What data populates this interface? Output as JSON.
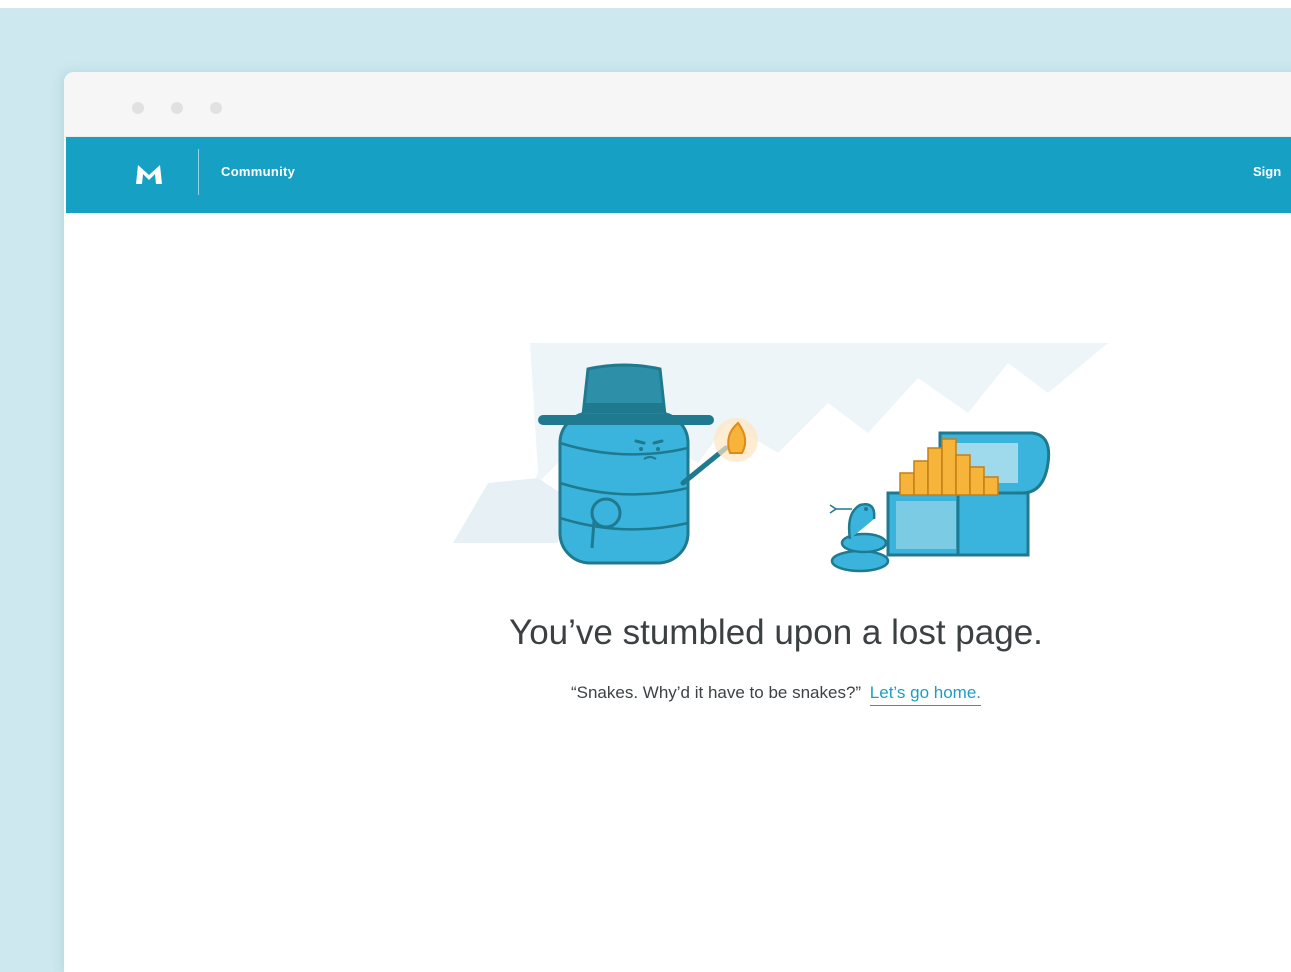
{
  "nav": {
    "logo_icon": "meetup-m-logo",
    "community_label": "Community",
    "sign_label": "Sign"
  },
  "error": {
    "headline": "You’ve stumbled upon a lost page.",
    "quote": "“Snakes. Why’d it have to be snakes?”",
    "home_link": "Let’s go home."
  },
  "colors": {
    "brand": "#16a0c4",
    "link": "#1d9ec3",
    "text": "#3b4043",
    "illustration_blue": "#3ab4dc",
    "illustration_dark": "#1f7a90",
    "torch_flame": "#f6b43a"
  }
}
